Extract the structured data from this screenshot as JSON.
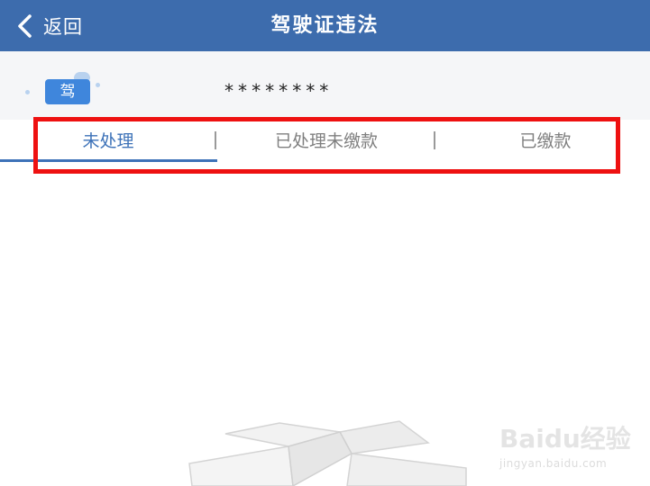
{
  "header": {
    "back_label": "返回",
    "title": "驾驶证违法"
  },
  "profile": {
    "badge_text": "驾",
    "masked_number": "********"
  },
  "tabs": [
    {
      "label": "未处理",
      "active": true
    },
    {
      "label": "已处理未缴款",
      "active": false
    },
    {
      "label": "已缴款",
      "active": false
    }
  ],
  "watermark": {
    "brand": "Baidu经验",
    "url": "jingyan.baidu.com"
  },
  "colors": {
    "header_bg": "#3d6cad",
    "active_tab": "#3d72b8",
    "highlight": "#ee1111"
  }
}
